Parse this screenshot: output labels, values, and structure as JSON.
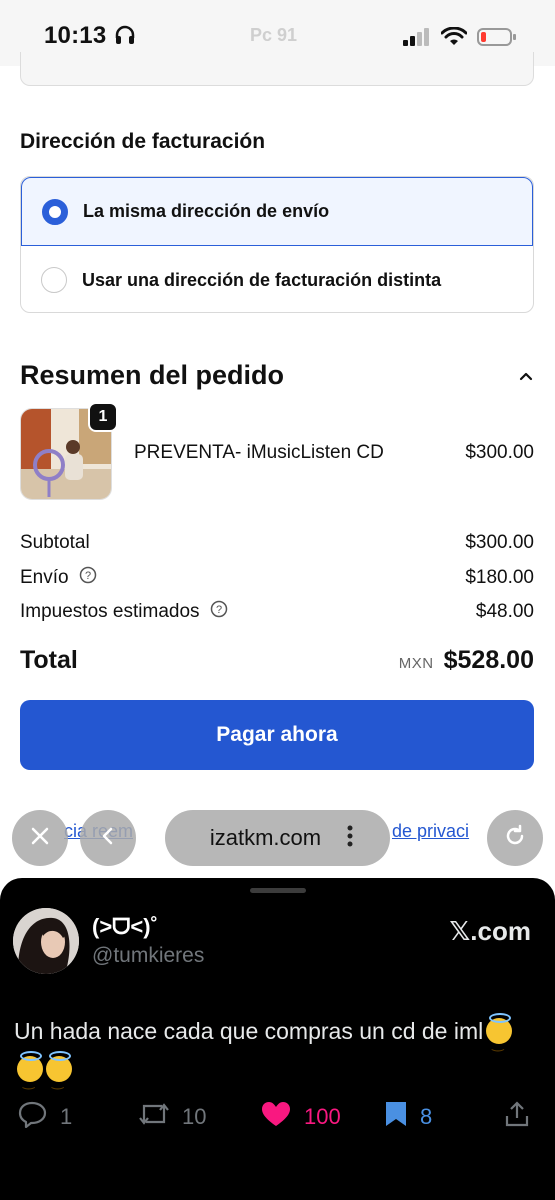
{
  "status_bar": {
    "time": "10:13",
    "ghost_text": "Pc 91",
    "icons": [
      "headphones-icon",
      "cellular-signal-icon",
      "wifi-icon",
      "battery-low-icon"
    ],
    "battery_color": "#ff3b30"
  },
  "billing": {
    "heading": "Dirección de facturación",
    "options": [
      {
        "label": "La misma dirección de envío",
        "selected": true
      },
      {
        "label": "Usar una dirección de facturación distinta",
        "selected": false
      }
    ]
  },
  "summary": {
    "heading": "Resumen del pedido",
    "item": {
      "quantity": "1",
      "name": "PREVENTA- iMusicListen CD",
      "price": "$300.00"
    },
    "lines": [
      {
        "label": "Subtotal",
        "value": "$300.00",
        "info": false
      },
      {
        "label": "Envío",
        "value": "$180.00",
        "info": true
      },
      {
        "label": "Impuestos estimados",
        "value": "$48.00",
        "info": true
      }
    ],
    "total_label": "Total",
    "currency": "MXN",
    "total_value": "$528.00",
    "pay_button": "Pagar ahora",
    "footer_link_1": "cia reem",
    "footer_link_2": "de privaci"
  },
  "browser": {
    "url": "izatkm.com"
  },
  "tweet": {
    "display_name": "(>ᗜ<)˚",
    "handle": "@tumkieres",
    "source": "𝕏.com",
    "text": "Un hada nace cada que compras un cd de iml",
    "counts": {
      "replies": "1",
      "reposts": "10",
      "likes": "100",
      "bookmarks": "8"
    },
    "colors": {
      "like": "#f91880",
      "bookmark": "#4a90e2",
      "muted": "#71767b"
    }
  },
  "colors": {
    "accent": "#2457d1",
    "selected_bg": "#f0f5ff"
  }
}
